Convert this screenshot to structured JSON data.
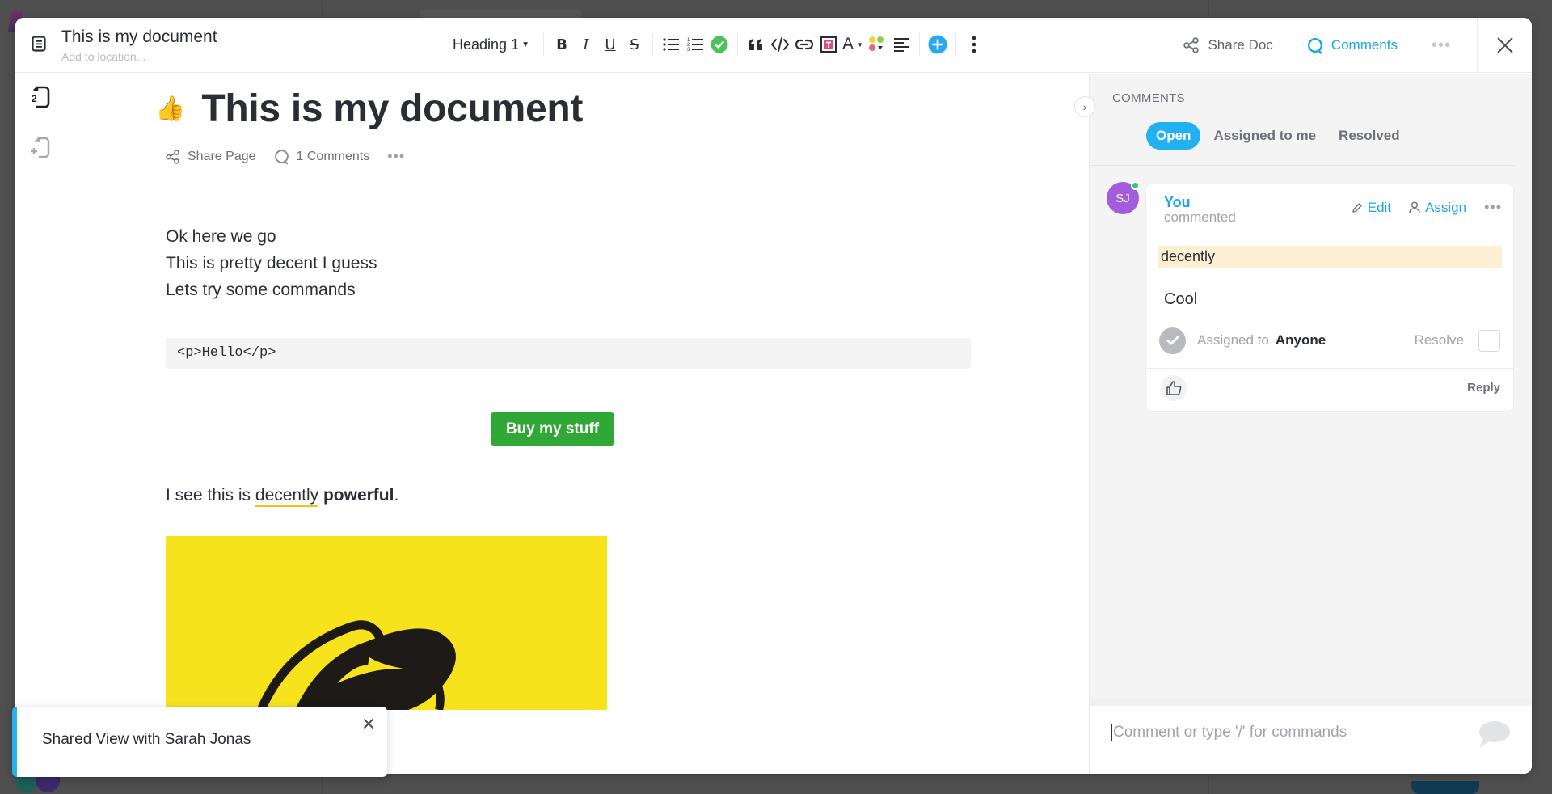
{
  "header": {
    "title": "This is my document",
    "location_placeholder": "Add to location...",
    "heading_select": "Heading 1",
    "share_doc": "Share Doc",
    "comments": "Comments"
  },
  "toolbar": {
    "bold": "B",
    "italic": "I",
    "underline": "U",
    "strike": "S",
    "font_color": "A"
  },
  "rail": {
    "pages_count": "2"
  },
  "document": {
    "emoji": "👍",
    "title": "This is my document",
    "share_page": "Share Page",
    "comments_count": "1 Comments",
    "lines": [
      "Ok here we go",
      "This is pretty decent I guess",
      "Lets try some commands"
    ],
    "code": "<p>Hello</p>",
    "button_label": "Buy my stuff",
    "sentence": {
      "prefix": "I see this is ",
      "highlighted": "decently",
      "space": " ",
      "bold": "powerful",
      "suffix": "."
    }
  },
  "comments_panel": {
    "label": "COMMENTS",
    "tabs": [
      "Open",
      "Assigned to me",
      "Resolved"
    ],
    "active_tab": "Open",
    "comment": {
      "avatar_initials": "SJ",
      "author": "You",
      "action": "commented",
      "edit": "Edit",
      "assign": "Assign",
      "quote": "decently",
      "body": "Cool",
      "assigned_to_label": "Assigned to",
      "assignee": "Anyone",
      "resolve": "Resolve",
      "reply": "Reply"
    },
    "input_placeholder": "Comment or type '/' for commands"
  },
  "toast": {
    "message": "Shared View with Sarah Jonas"
  },
  "colors": {
    "accent": "#1aa6e6",
    "button_green": "#30a836",
    "avatar": "#a25ddc",
    "highlight": "#fdf0d2",
    "banner_yellow": "#f7e31c"
  }
}
